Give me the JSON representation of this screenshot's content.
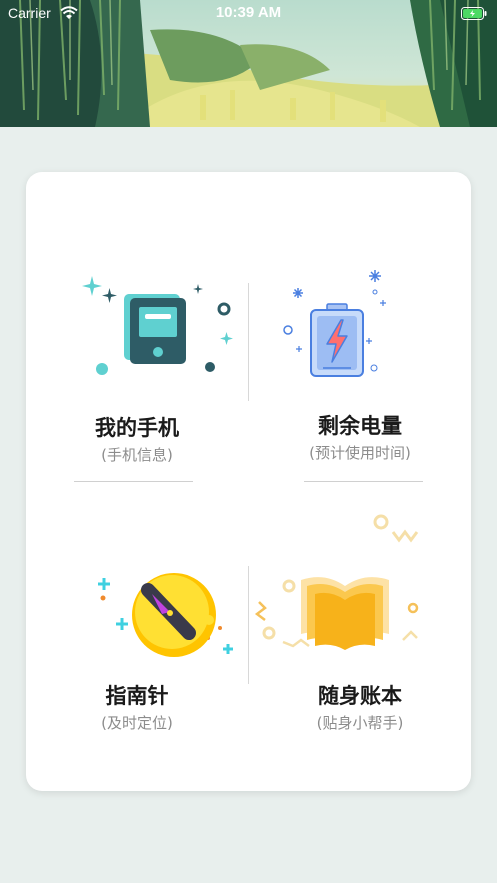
{
  "status_bar": {
    "carrier": "Carrier",
    "time": "10:39 AM"
  },
  "banner": {
    "image": "forest-waterfall-illustration"
  },
  "grid": {
    "tiles": [
      {
        "title": "我的手机",
        "subtitle": "(手机信息)",
        "icon": "phone-icon"
      },
      {
        "title": "剩余电量",
        "subtitle": "(预计使用时间)",
        "icon": "battery-icon"
      },
      {
        "title": "指南针",
        "subtitle": "(及时定位)",
        "icon": "compass-icon"
      },
      {
        "title": "随身账本",
        "subtitle": "(贴身小帮手)",
        "icon": "book-icon"
      }
    ]
  },
  "colors": {
    "background": "#e8efed",
    "teal": "#5fd0d0",
    "dark_teal": "#2e5c66",
    "battery_blue": "#4a7fe0",
    "compass_yellow": "#ffd21f",
    "book_orange": "#f7b21a"
  }
}
